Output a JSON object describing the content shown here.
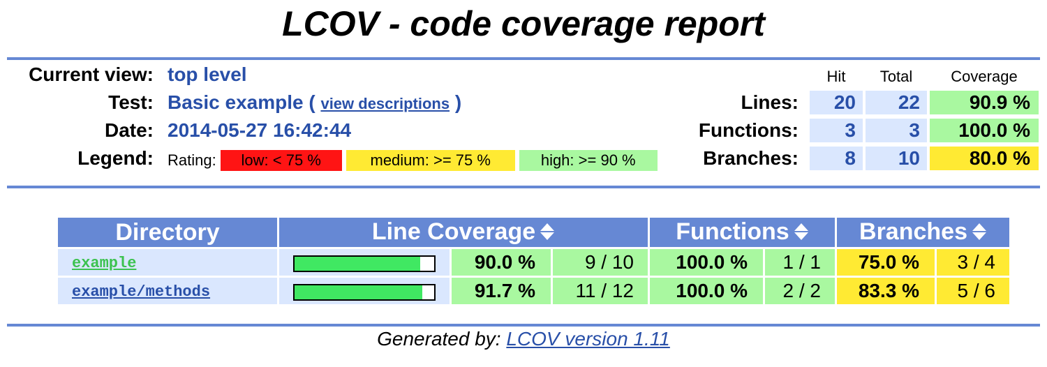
{
  "page_title": "LCOV - code coverage report",
  "header": {
    "current_view_label": "Current view:",
    "current_view_value": "top level",
    "test_label": "Test:",
    "test_value": "Basic example (",
    "test_link": "view descriptions",
    "test_close": ")",
    "date_label": "Date:",
    "date_value": "2014-05-27 16:42:44",
    "legend_label": "Legend:",
    "legend_rating": "Rating:",
    "legend_low": "low: < 75 %",
    "legend_medium": "medium: >= 75 %",
    "legend_high": "high: >= 90 %"
  },
  "summary": {
    "columns": {
      "hit": "Hit",
      "total": "Total",
      "coverage": "Coverage"
    },
    "rows": [
      {
        "label": "Lines:",
        "hit": "20",
        "total": "22",
        "coverage": "90.9 %",
        "rating": "high"
      },
      {
        "label": "Functions:",
        "hit": "3",
        "total": "3",
        "coverage": "100.0 %",
        "rating": "high"
      },
      {
        "label": "Branches:",
        "hit": "8",
        "total": "10",
        "coverage": "80.0 %",
        "rating": "medium"
      }
    ]
  },
  "table": {
    "headers": {
      "directory": "Directory",
      "line_coverage": "Line Coverage",
      "functions": "Functions",
      "branches": "Branches"
    },
    "rows": [
      {
        "dir": "example",
        "line_fraction": 0.9,
        "line_pct": "90.0 %",
        "line_count": "9 / 10",
        "func_pct": "100.0 %",
        "func_count": "1 / 1",
        "branch_pct": "75.0 %",
        "branch_count": "3 / 4",
        "visited": true
      },
      {
        "dir": "example/methods",
        "line_fraction": 0.917,
        "line_pct": "91.7 %",
        "line_count": "11 / 12",
        "func_pct": "100.0 %",
        "func_count": "2 / 2",
        "branch_pct": "83.3 %",
        "branch_count": "5 / 6",
        "visited": false
      }
    ]
  },
  "footer": {
    "generated_by": "Generated by:",
    "link": "LCOV version 1.11"
  },
  "colors": {
    "rule": "#6688d4",
    "link": "#284fa8",
    "visited": "#3cc24f",
    "high": "#a9f8a0",
    "medium": "#ffea33",
    "low": "#ff1414",
    "bar": "#40e862",
    "num_bg": "#dae7fe"
  }
}
